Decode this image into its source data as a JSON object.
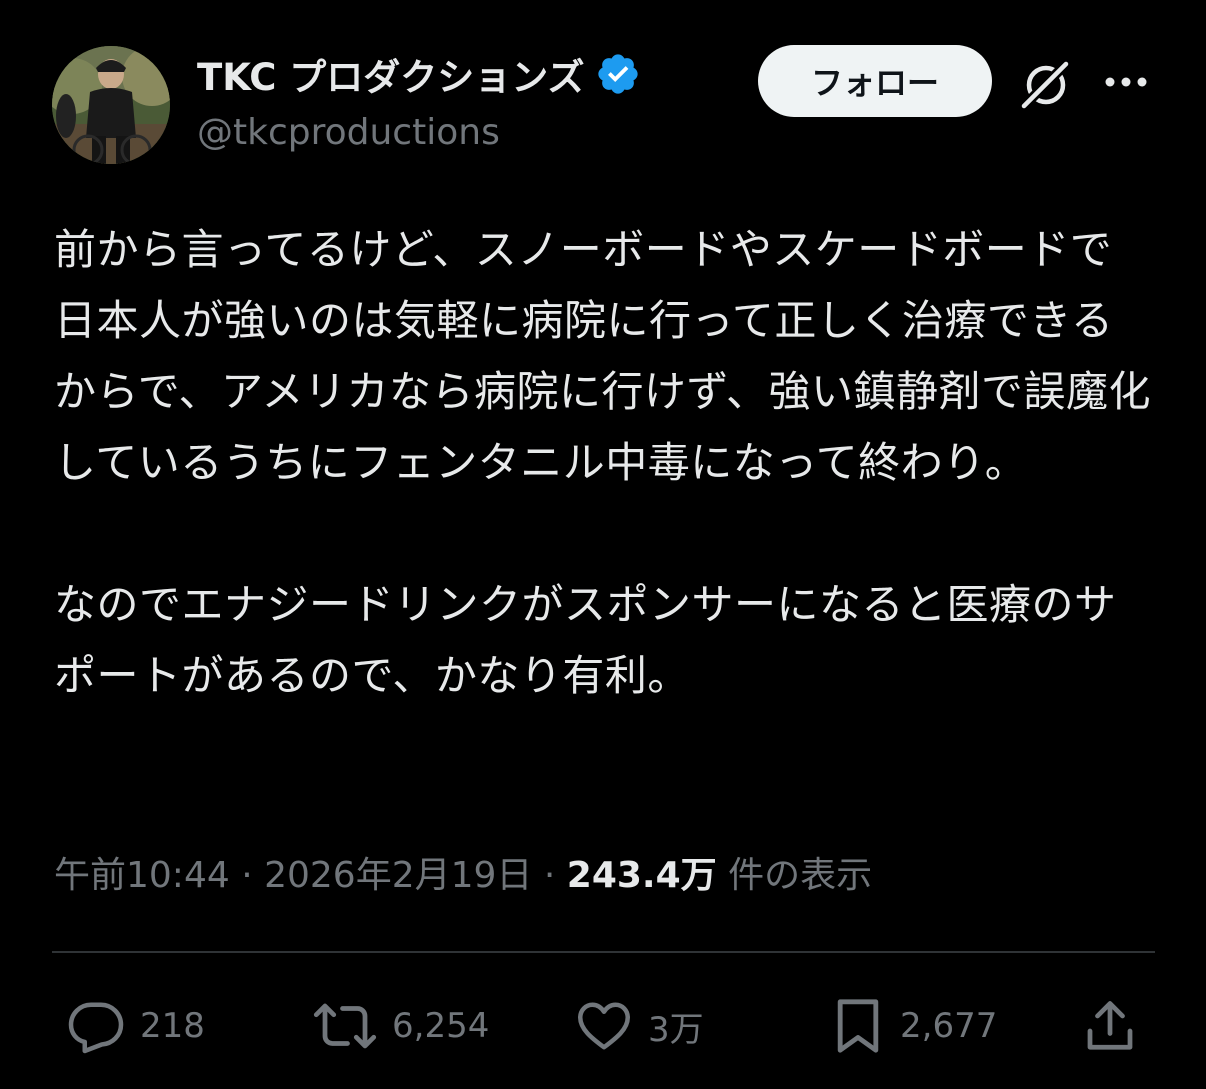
{
  "author": {
    "display_name": "TKC プロダクションズ",
    "handle": "@tkcproductions",
    "verified_color": "#1d9bf0"
  },
  "toolbar": {
    "follow_label": "フォロー",
    "grok_icon": "grok-icon",
    "more_icon": "more-icon"
  },
  "tweet": {
    "paragraph1": "前から言ってるけど、スノーボードやスケードボードで日本人が強いのは気軽に病院に行って正しく治療できるからで、アメリカなら病院に行けず、強い鎮静剤で誤魔化しているうちにフェンタニル中毒になって終わり。",
    "paragraph2": "なのでエナジードリンクがスポンサーになると医療のサポートがあるので、かなり有利。"
  },
  "meta": {
    "time": "午前10:44",
    "separator": " · ",
    "date": "2026年2月19日",
    "views_count": "243.4万",
    "views_label": " 件の表示"
  },
  "actions": {
    "replies": "218",
    "reposts": "6,254",
    "likes": "3万",
    "bookmarks": "2,677"
  },
  "colors": {
    "background": "#000000",
    "text": "#e7e9ea",
    "secondary_text": "#71767b",
    "divider": "#2f3336",
    "follow_bg": "#eff3f4"
  }
}
